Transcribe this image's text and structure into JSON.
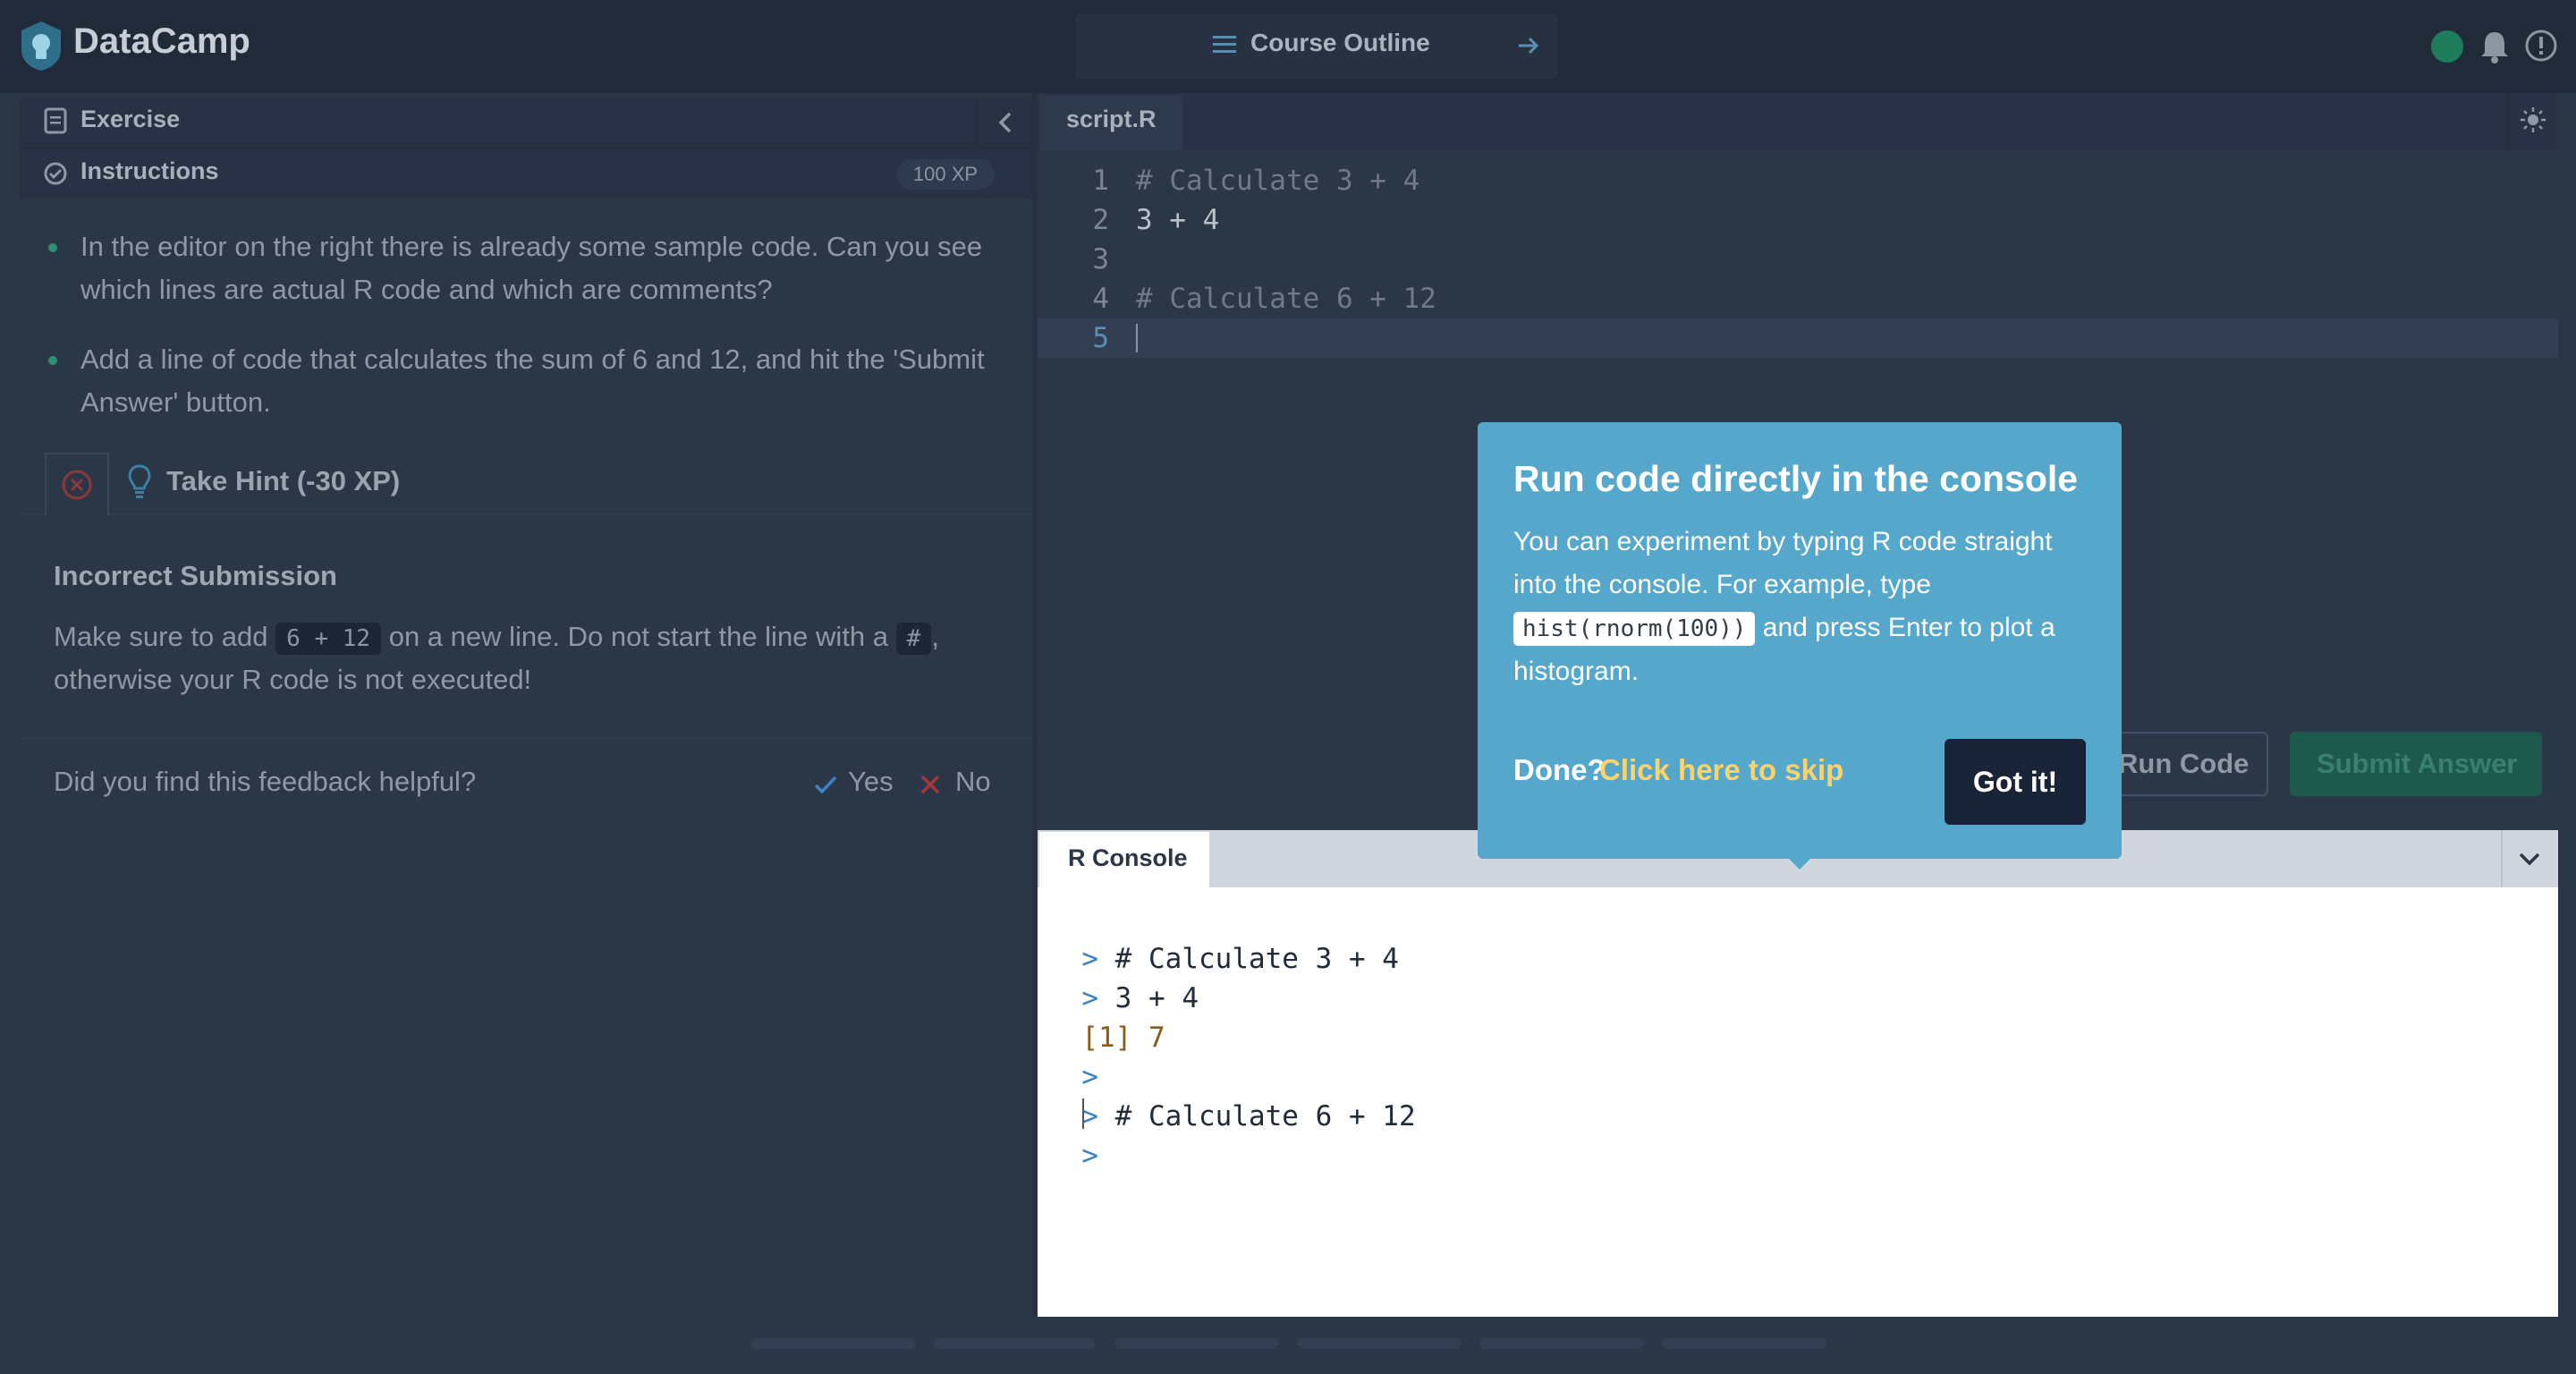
{
  "header": {
    "brand": "DataCamp",
    "course_outline": "Course Outline",
    "colors": {
      "status": "#1f7d5c"
    }
  },
  "left": {
    "exercise": "Exercise",
    "instructions": "Instructions",
    "xp": "100 XP",
    "bullets": [
      "In the editor on the right there is already some sample code. Can you see which lines are actual R code and which are comments?",
      "Add a line of code that calculates the sum of 6 and 12, and hit the 'Submit Answer' button."
    ],
    "hint": "Take Hint (-30 XP)",
    "feedback": {
      "title": "Incorrect Submission",
      "p1": "Make sure to add",
      "code1": "6 + 12",
      "p2": "on a new line. Do not start the line with a",
      "code2": "#",
      "p3": ",",
      "p4": "otherwise your R code is not executed!"
    },
    "helpful": {
      "question": "Did you find this feedback helpful?",
      "yes": "Yes",
      "no": "No"
    }
  },
  "editor": {
    "tab": "script.R",
    "lines": [
      {
        "no": "1",
        "code": "# Calculate 3 + 4",
        "kind": "comment"
      },
      {
        "no": "2",
        "code": "3 + 4",
        "kind": "code"
      },
      {
        "no": "3",
        "code": "",
        "kind": "code"
      },
      {
        "no": "4",
        "code": "# Calculate 6 + 12",
        "kind": "comment"
      },
      {
        "no": "5",
        "code": "",
        "kind": "code"
      }
    ],
    "run": "Run Code",
    "submit": "Submit Answer"
  },
  "console": {
    "tab": "R Console",
    "lines": [
      {
        "prompt": ">",
        "text": "# Calculate 3 + 4",
        "kind": "in"
      },
      {
        "prompt": ">",
        "text": "3 + 4",
        "kind": "in"
      },
      {
        "prompt": "",
        "text": "[1] 7",
        "kind": "out"
      },
      {
        "prompt": ">",
        "text": "",
        "kind": "in"
      },
      {
        "prompt": ">",
        "text": "# Calculate 6 + 12",
        "kind": "in"
      },
      {
        "prompt": ">",
        "text": "",
        "kind": "in"
      }
    ]
  },
  "tooltip": {
    "title": "Run code directly in the console",
    "body1": "You can experiment by typing R code straight into the console. For example, type",
    "code": "hist(rnorm(100))",
    "body2": "and press Enter to plot a histogram.",
    "done": "Done?",
    "skip": "Click here to skip",
    "button": "Got it!",
    "colors": {
      "background": "#55a7cb",
      "link": "#fcd36b"
    }
  },
  "icons": [
    "logo-mark",
    "menu-icon",
    "arrow-right-icon",
    "bell-icon",
    "info-icon",
    "document-icon",
    "check-circle-icon",
    "chevron-left-icon",
    "close-circle-icon",
    "lightbulb-icon",
    "check-icon",
    "x-icon",
    "sun-icon",
    "chevron-down-icon"
  ]
}
